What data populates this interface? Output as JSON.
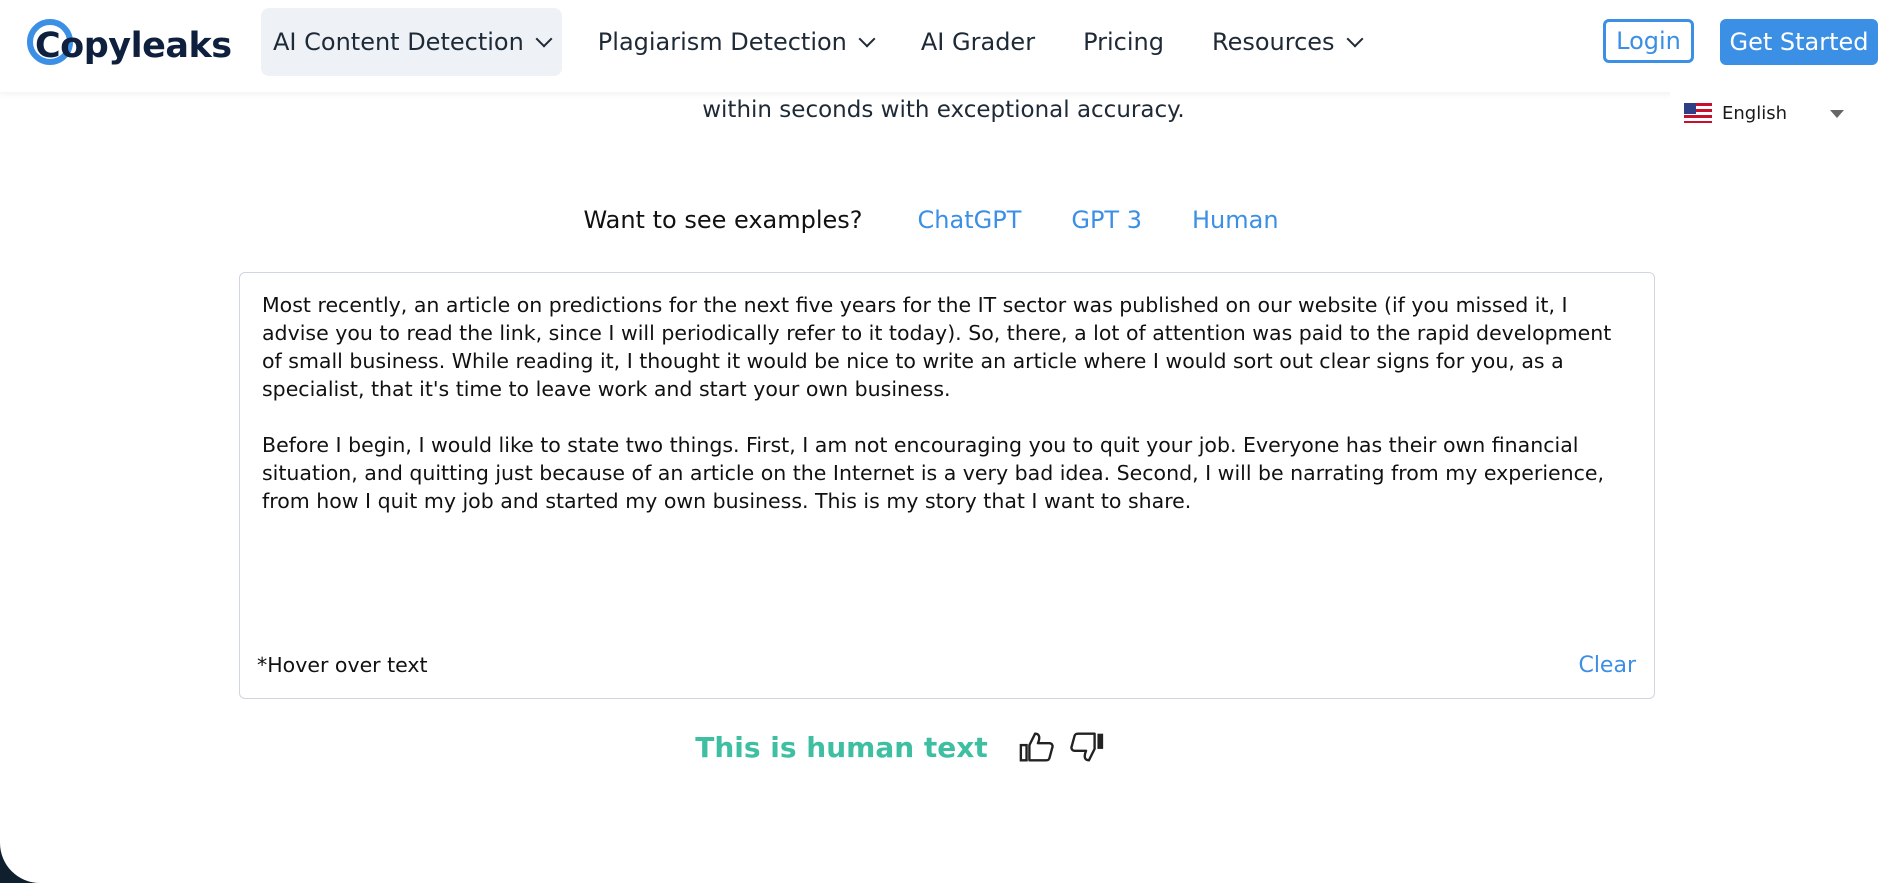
{
  "header": {
    "logo_text": "Copyleaks",
    "nav": [
      {
        "label": "AI Content Detection",
        "has_dropdown": true,
        "active": true
      },
      {
        "label": "Plagiarism Detection",
        "has_dropdown": true
      },
      {
        "label": "AI Grader",
        "has_dropdown": false
      },
      {
        "label": "Pricing",
        "has_dropdown": false
      },
      {
        "label": "Resources",
        "has_dropdown": true
      }
    ],
    "login_label": "Login",
    "get_started_label": "Get Started"
  },
  "language": {
    "label": "English",
    "icon": "us-flag-icon"
  },
  "hero": {
    "line2": "within seconds with exceptional accuracy."
  },
  "examples": {
    "prompt": "Want to see examples?",
    "links": [
      "ChatGPT",
      "GPT 3",
      "Human"
    ]
  },
  "editor": {
    "paragraph1": "Most recently, an article on predictions for the next five years for the IT sector was published on our website (if you missed it, I advise you to read the link, since I will periodically refer to it today). So, there, a lot of attention was paid to the rapid development of small business. While reading it, I thought it would be nice to write an article where I would sort out clear signs for you, as a specialist, that it's time to leave work and start your own business.",
    "paragraph2": "Before I begin, I would like to state two things. First, I am not encouraging you to quit your job. Everyone has their own financial situation, and quitting just because of an article on the Internet is a very bad idea. Second, I will be narrating from my experience, from how I quit my job and started my own business. This is my story that I want to share.",
    "hover_note": "*Hover over text",
    "clear_label": "Clear"
  },
  "result": {
    "text": "This is human text",
    "color": "#3fbfa2"
  },
  "colors": {
    "accent": "#3b8fe5",
    "dark": "#0f1f2e"
  }
}
